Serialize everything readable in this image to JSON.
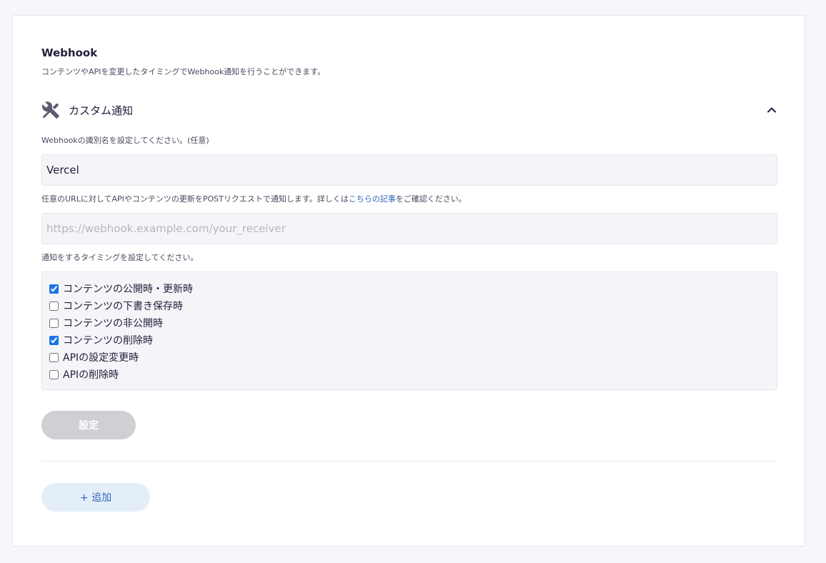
{
  "header": {
    "title": "Webhook",
    "description": "コンテンツやAPIを変更したタイミングでWebhook通知を行うことができます。"
  },
  "section": {
    "title": "カスタム通知",
    "icon": "tools-icon",
    "toggle_icon": "chevron-up-icon"
  },
  "name_field": {
    "label": "Webhookの識別名を設定してください。(任意)",
    "value": "Vercel",
    "placeholder": ""
  },
  "url_field": {
    "label_prefix": "任意のURLに対してAPIやコンテンツの更新をPOSTリクエストで通知します。詳しくは",
    "label_link": "こちらの記事",
    "label_suffix": "をご確認ください。",
    "value": "",
    "placeholder": "https://webhook.example.com/your_receiver"
  },
  "timing": {
    "label": "通知をするタイミングを設定してください。",
    "options": [
      {
        "label": "コンテンツの公開時・更新時",
        "checked": true
      },
      {
        "label": "コンテンツの下書き保存時",
        "checked": false
      },
      {
        "label": "コンテンツの非公開時",
        "checked": false
      },
      {
        "label": "コンテンツの削除時",
        "checked": true
      },
      {
        "label": "APIの設定変更時",
        "checked": false
      },
      {
        "label": "APIの削除時",
        "checked": false
      }
    ]
  },
  "actions": {
    "submit_label": "設定",
    "add_label": "+ 追加"
  },
  "colors": {
    "link": "#3166b8",
    "submit_disabled": "#cfcfd4",
    "add_bg": "#e4eef9",
    "checkbox_accent": "#1a73e8"
  }
}
